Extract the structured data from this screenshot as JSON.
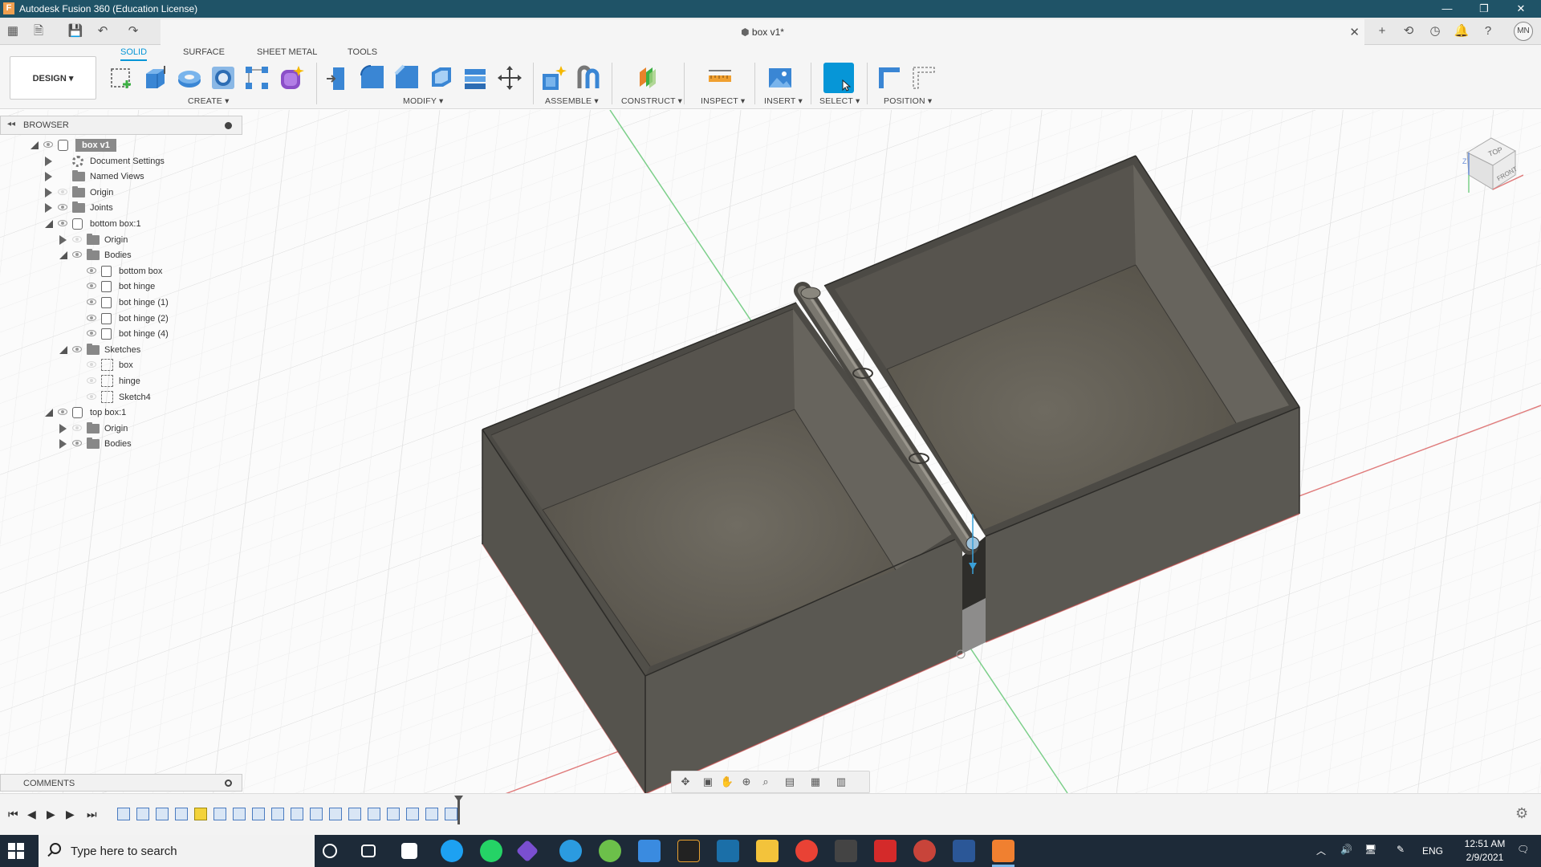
{
  "window": {
    "title": "Autodesk Fusion 360 (Education License)",
    "minimize": "—",
    "maximize": "❐",
    "close": "✕"
  },
  "document_tab": {
    "title": "box v1*",
    "close": "✕"
  },
  "user": {
    "initials": "MN"
  },
  "workspace": {
    "label": "DESIGN ▾"
  },
  "ribbon_tabs": [
    "SOLID",
    "SURFACE",
    "SHEET METAL",
    "TOOLS"
  ],
  "ribbon_groups": {
    "create": "CREATE ▾",
    "modify": "MODIFY ▾",
    "assemble": "ASSEMBLE ▾",
    "construct": "CONSTRUCT ▾",
    "inspect": "INSPECT ▾",
    "insert": "INSERT ▾",
    "select": "SELECT ▾",
    "position": "POSITION ▾"
  },
  "browser": {
    "title": "BROWSER",
    "items": [
      {
        "label": "box v1",
        "level": 0,
        "icon": "component",
        "expanded": true,
        "visible": true
      },
      {
        "label": "Document Settings",
        "level": 1,
        "icon": "gear",
        "expanded": false,
        "visible": null
      },
      {
        "label": "Named Views",
        "level": 1,
        "icon": "folder",
        "expanded": false,
        "visible": null
      },
      {
        "label": "Origin",
        "level": 1,
        "icon": "folder",
        "expanded": false,
        "visible": false
      },
      {
        "label": "Joints",
        "level": 1,
        "icon": "folder",
        "expanded": false,
        "visible": true
      },
      {
        "label": "bottom box:1",
        "level": 1,
        "icon": "component",
        "expanded": true,
        "visible": true
      },
      {
        "label": "Origin",
        "level": 2,
        "icon": "folder",
        "expanded": false,
        "visible": false
      },
      {
        "label": "Bodies",
        "level": 2,
        "icon": "folder",
        "expanded": true,
        "visible": true
      },
      {
        "label": "bottom box",
        "level": 3,
        "icon": "body",
        "expanded": null,
        "visible": true
      },
      {
        "label": "bot hinge",
        "level": 3,
        "icon": "body",
        "expanded": null,
        "visible": true
      },
      {
        "label": "bot hinge (1)",
        "level": 3,
        "icon": "body",
        "expanded": null,
        "visible": true
      },
      {
        "label": "bot hinge (2)",
        "level": 3,
        "icon": "body",
        "expanded": null,
        "visible": true
      },
      {
        "label": "bot hinge (4)",
        "level": 3,
        "icon": "body",
        "expanded": null,
        "visible": true
      },
      {
        "label": "Sketches",
        "level": 2,
        "icon": "folder",
        "expanded": true,
        "visible": true
      },
      {
        "label": "box",
        "level": 3,
        "icon": "sketch",
        "expanded": null,
        "visible": false
      },
      {
        "label": "hinge",
        "level": 3,
        "icon": "sketch",
        "expanded": null,
        "visible": false
      },
      {
        "label": "Sketch4",
        "level": 3,
        "icon": "sketch",
        "expanded": null,
        "visible": false
      },
      {
        "label": "top box:1",
        "level": 1,
        "icon": "component",
        "expanded": true,
        "visible": true
      },
      {
        "label": "Origin",
        "level": 2,
        "icon": "folder",
        "expanded": false,
        "visible": false
      },
      {
        "label": "Bodies",
        "level": 2,
        "icon": "folder",
        "expanded": false,
        "visible": true
      }
    ]
  },
  "comments": {
    "title": "COMMENTS"
  },
  "viewcube": {
    "top": "TOP",
    "front": "FRONT",
    "axis_z": "Z"
  },
  "taskbar": {
    "search_placeholder": "Type here to search",
    "language": "ENG",
    "time": "12:51 AM",
    "date": "2/9/2021"
  },
  "colors": {
    "titlebar": "#1f5367",
    "accent": "#0696d7",
    "model": "#5c5a54",
    "taskbar": "#1d2a38"
  }
}
